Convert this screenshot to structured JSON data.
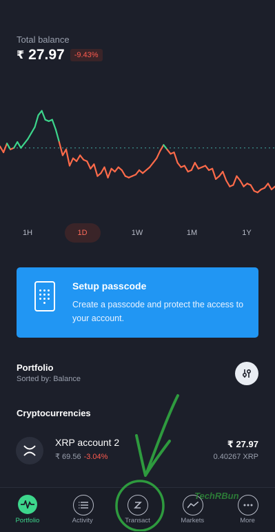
{
  "balance": {
    "label": "Total balance",
    "currency_symbol": "₹",
    "amount": "27.97",
    "change": "-9.43%",
    "change_color": "#ff5b4f"
  },
  "chart_data": {
    "type": "line",
    "x": [
      0,
      5,
      10,
      15,
      20,
      25,
      30,
      35,
      40,
      45,
      50,
      55,
      60,
      65,
      70,
      75,
      80,
      85,
      90,
      95,
      100,
      105,
      110,
      115,
      120,
      125,
      130,
      135,
      140,
      145,
      150,
      155,
      160,
      165,
      170,
      175,
      180,
      185,
      190,
      195,
      200,
      205,
      210,
      215,
      220,
      225,
      230,
      235,
      240,
      245,
      250,
      255,
      260,
      265,
      270,
      275,
      280,
      285,
      290,
      295,
      300,
      305,
      310,
      315,
      320,
      325,
      330,
      335,
      340,
      345,
      350,
      355,
      360,
      365,
      370,
      375,
      380,
      385,
      390,
      395
    ],
    "values": [
      58,
      66,
      54,
      62,
      60,
      52,
      60,
      54,
      48,
      40,
      32,
      16,
      10,
      22,
      24,
      22,
      35,
      52,
      70,
      62,
      84,
      74,
      78,
      70,
      76,
      78,
      88,
      82,
      98,
      94,
      86,
      100,
      88,
      92,
      86,
      90,
      98,
      100,
      98,
      96,
      90,
      94,
      90,
      86,
      80,
      74,
      64,
      56,
      62,
      68,
      66,
      80,
      86,
      84,
      92,
      90,
      80,
      88,
      86,
      84,
      90,
      88,
      102,
      98,
      92,
      104,
      112,
      110,
      98,
      104,
      112,
      108,
      110,
      118,
      120,
      116,
      114,
      108,
      116,
      112
    ],
    "baseline": 60,
    "ylim": [
      0,
      130
    ],
    "gain_color": "#3dd68c",
    "loss_color": "#ff6b4a",
    "grid": false
  },
  "ranges": [
    {
      "label": "1H"
    },
    {
      "label": "1D"
    },
    {
      "label": "1W"
    },
    {
      "label": "1M"
    },
    {
      "label": "1Y"
    }
  ],
  "banner": {
    "title": "Setup passcode",
    "text": "Create a passcode and protect the access to your account.",
    "color": "#2196f3"
  },
  "portfolio": {
    "title": "Portfolio",
    "subtitle": "Sorted by: Balance"
  },
  "crypto": {
    "title": "Cryptocurrencies",
    "assets": [
      {
        "name": "XRP account 2",
        "price": "₹ 69.56",
        "change": "-3.04%",
        "value": "₹ 27.97",
        "units": "0.40267 XRP"
      }
    ]
  },
  "nav": [
    {
      "label": "Portfolio",
      "icon": "portfolio-icon"
    },
    {
      "label": "Activity",
      "icon": "list-icon"
    },
    {
      "label": "Transact",
      "icon": "transact-icon"
    },
    {
      "label": "Markets",
      "icon": "markets-icon"
    },
    {
      "label": "More",
      "icon": "more-icon"
    }
  ],
  "watermark": "TechRBun"
}
